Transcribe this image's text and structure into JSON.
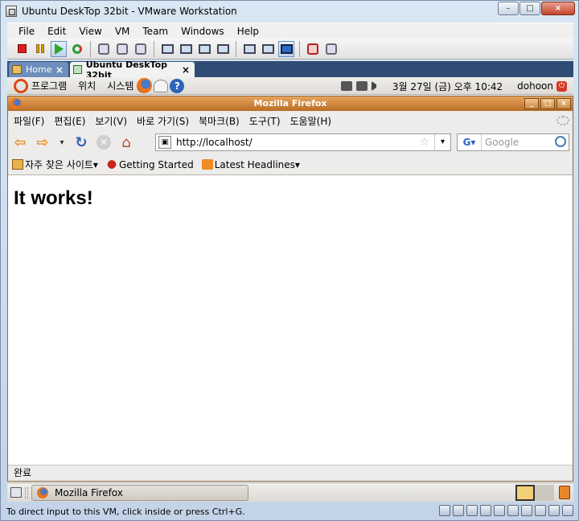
{
  "vmware": {
    "window_title": "Ubuntu DeskTop 32bit - VMware Workstation",
    "window_controls": [
      "–",
      "□",
      "×"
    ],
    "menu": [
      "File",
      "Edit",
      "View",
      "VM",
      "Team",
      "Windows",
      "Help"
    ],
    "tabs": [
      {
        "label": "Home",
        "close": "×"
      },
      {
        "label": "Ubuntu DeskTop 32bit",
        "close": "×"
      }
    ],
    "status_hint": "To direct input to this VM, click inside or press Ctrl+G."
  },
  "gnome": {
    "menus": [
      "프로그램",
      "위치",
      "시스템"
    ],
    "help_glyph": "?",
    "clock": "3월 27일 (금) 오후 10:42",
    "user": "dohoon",
    "taskbar_item": "Mozilla Firefox"
  },
  "firefox": {
    "title": "Mozilla Firefox",
    "window_controls": [
      "_",
      "□",
      "×"
    ],
    "menu": [
      "파일(F)",
      "편집(E)",
      "보기(V)",
      "바로 가기(S)",
      "북마크(B)",
      "도구(T)",
      "도움말(H)"
    ],
    "nav": {
      "back": "⇦",
      "forward": "⇨",
      "history": "▾",
      "reload": "↻",
      "stop": "✕",
      "home": "⌂"
    },
    "url": "http://localhost/",
    "site_icon": "▣",
    "star": "☆",
    "url_drop": "▾",
    "search": {
      "engine": "G▾",
      "placeholder": "Google"
    },
    "bookmarks": [
      {
        "label": "자주 찾은 사이트▾"
      },
      {
        "label": "Getting Started"
      },
      {
        "label": "Latest Headlines▾"
      }
    ],
    "page_heading": "It works!",
    "status": "완료"
  },
  "colors": {
    "firefox_title": "#c97a32",
    "vm_tabbar": "#2f4c74",
    "ubuntu_orange": "#dd4814"
  }
}
